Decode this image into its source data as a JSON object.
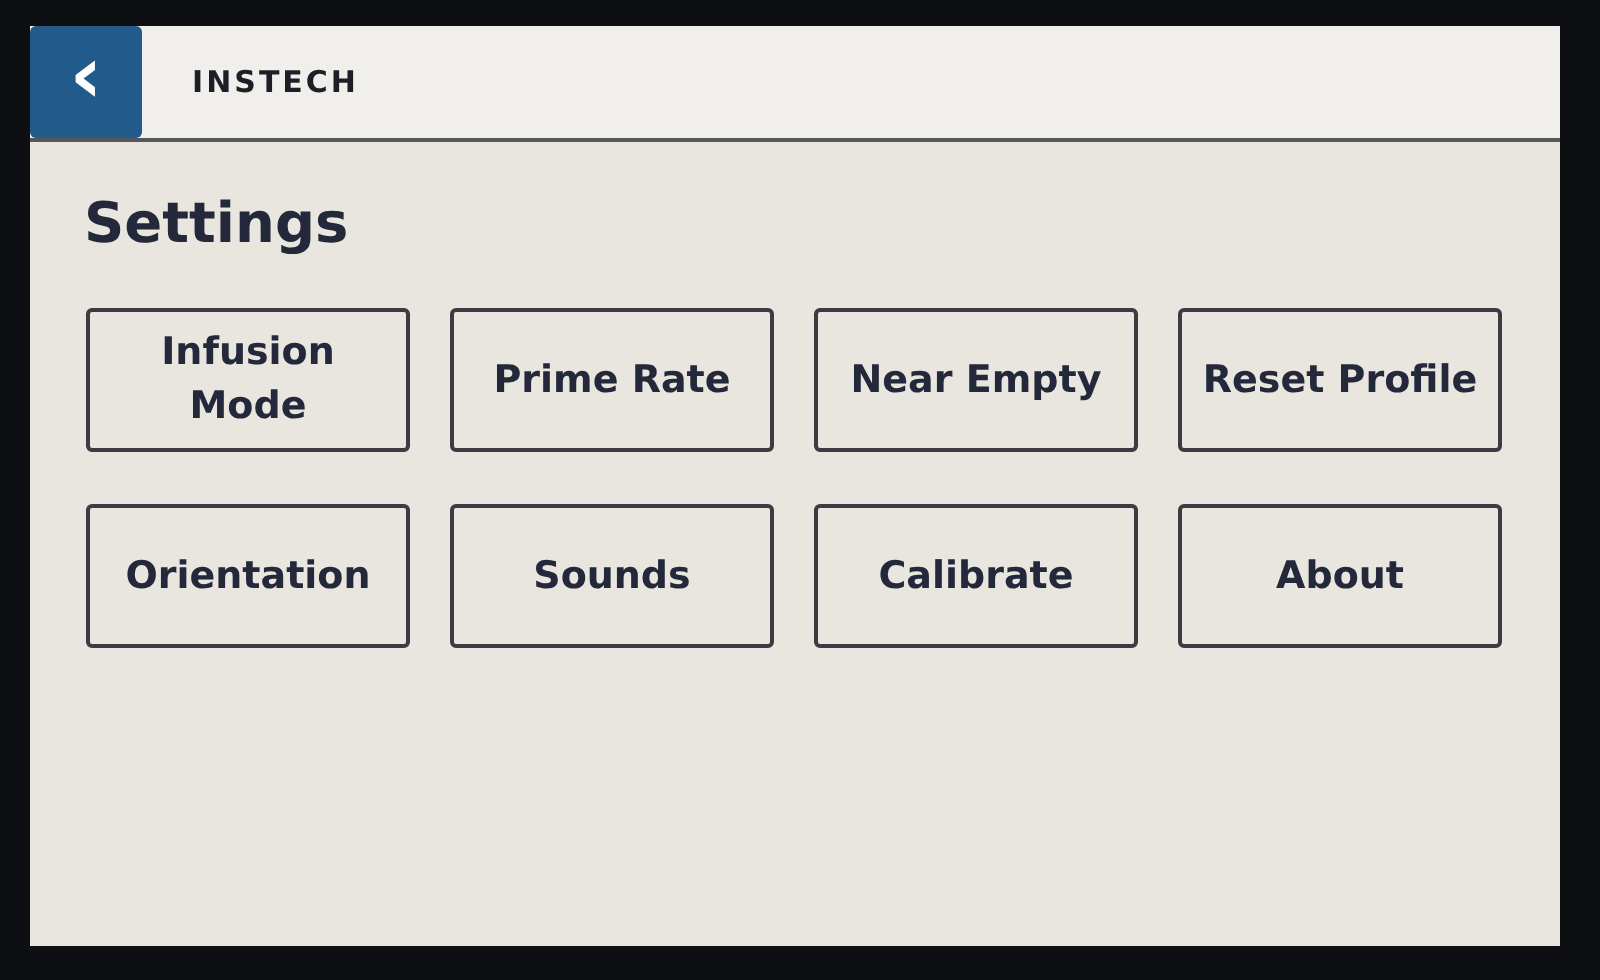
{
  "header": {
    "back_icon": "‹",
    "brand": "INSTECH"
  },
  "title": "Settings",
  "buttons": [
    {
      "label": "Infusion Mode"
    },
    {
      "label": "Prime Rate"
    },
    {
      "label": "Near Empty"
    },
    {
      "label": "Reset Profile"
    },
    {
      "label": "Orientation"
    },
    {
      "label": "Sounds"
    },
    {
      "label": "Calibrate"
    },
    {
      "label": "About"
    }
  ]
}
